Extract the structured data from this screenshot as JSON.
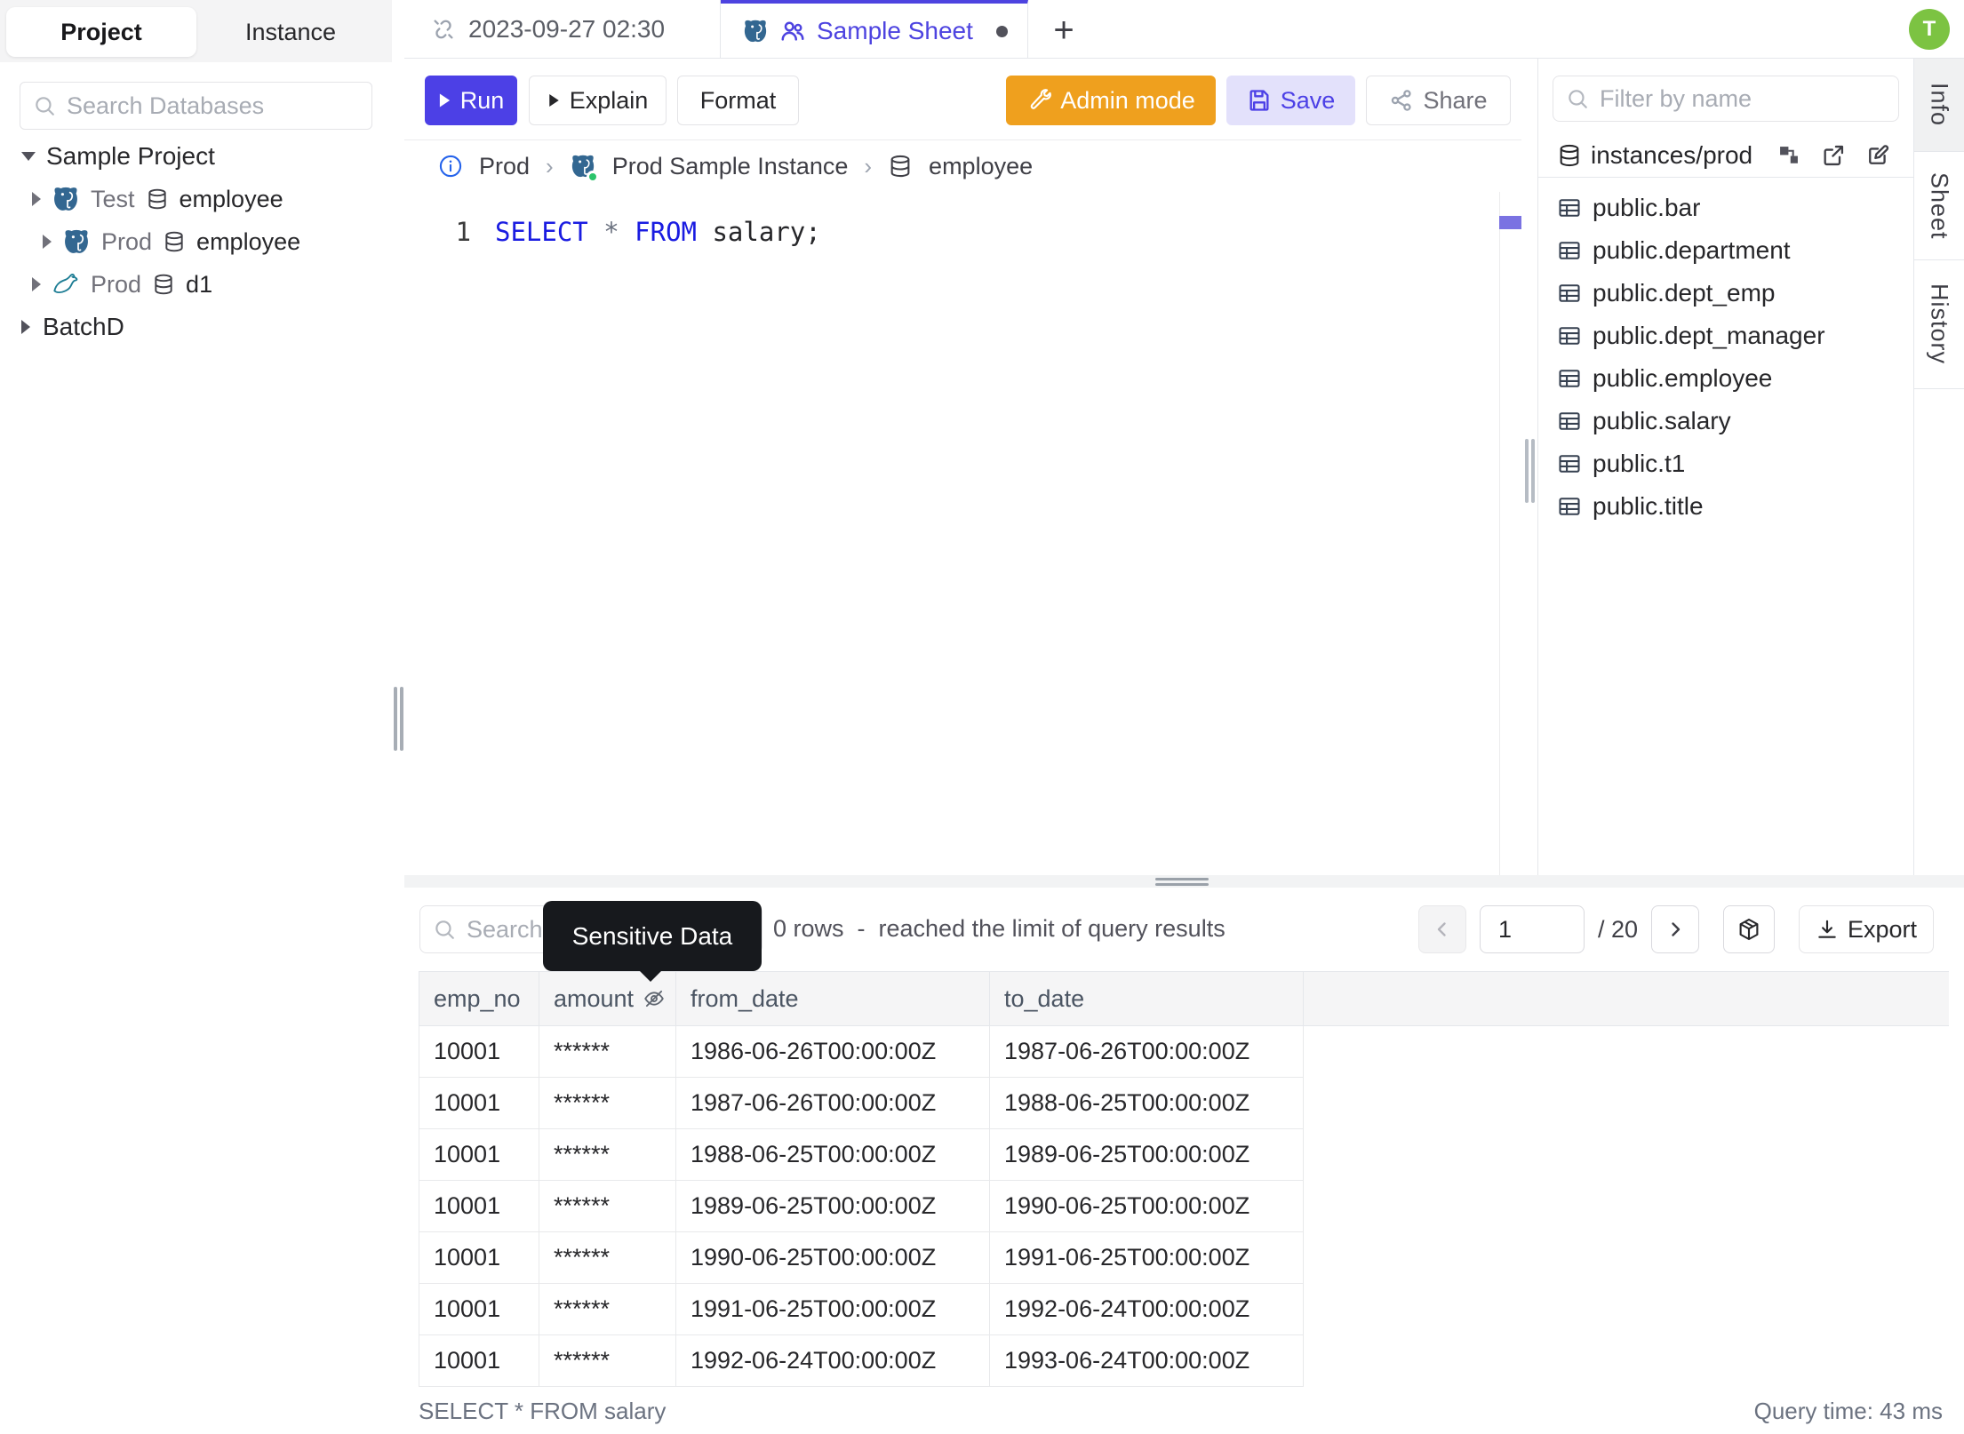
{
  "app": {
    "avatar_initial": "T"
  },
  "sidebar": {
    "tabs": {
      "project": "Project",
      "instance": "Instance"
    },
    "search_placeholder": "Search Databases",
    "tree": {
      "root_label": "Sample Project",
      "databases": [
        {
          "env": "Test",
          "name": "employee",
          "engine": "postgresql"
        },
        {
          "env": "Prod",
          "name": "employee",
          "engine": "postgresql"
        },
        {
          "env": "Prod",
          "name": "d1",
          "engine": "mysql"
        }
      ],
      "batch_label": "BatchD"
    }
  },
  "tabbar": {
    "history_tab": "2023-09-27 02:30",
    "sheet_tab": "Sample Sheet",
    "new_tab": "+"
  },
  "toolbar": {
    "run": "Run",
    "explain": "Explain",
    "format": "Format",
    "admin_mode": "Admin mode",
    "save": "Save",
    "share": "Share"
  },
  "breadcrumb": {
    "environment": "Prod",
    "instance": "Prod Sample Instance",
    "database": "employee",
    "separator": "›"
  },
  "editor": {
    "line_number": "1",
    "kw1": "SELECT",
    "star": "*",
    "kw2": "FROM",
    "rest": " salary;"
  },
  "right_panel": {
    "filter_placeholder": "Filter by name",
    "schema_path": "instances/prod",
    "tables": [
      "public.bar",
      "public.department",
      "public.dept_emp",
      "public.dept_manager",
      "public.employee",
      "public.salary",
      "public.t1",
      "public.title"
    ]
  },
  "side_tabs": {
    "info": "Info",
    "sheet": "Sheet",
    "history": "History"
  },
  "results": {
    "search_placeholder": "Search",
    "tooltip": "Sensitive Data",
    "summary": "0 rows  -  reached the limit of query results",
    "page_current": "1",
    "page_total": "/ 20",
    "export_label": "Export",
    "columns": [
      "emp_no",
      "amount",
      "from_date",
      "to_date"
    ],
    "rows": [
      [
        "10001",
        "******",
        "1986-06-26T00:00:00Z",
        "1987-06-26T00:00:00Z"
      ],
      [
        "10001",
        "******",
        "1987-06-26T00:00:00Z",
        "1988-06-25T00:00:00Z"
      ],
      [
        "10001",
        "******",
        "1988-06-25T00:00:00Z",
        "1989-06-25T00:00:00Z"
      ],
      [
        "10001",
        "******",
        "1989-06-25T00:00:00Z",
        "1990-06-25T00:00:00Z"
      ],
      [
        "10001",
        "******",
        "1990-06-25T00:00:00Z",
        "1991-06-25T00:00:00Z"
      ],
      [
        "10001",
        "******",
        "1991-06-25T00:00:00Z",
        "1992-06-24T00:00:00Z"
      ],
      [
        "10001",
        "******",
        "1992-06-24T00:00:00Z",
        "1993-06-24T00:00:00Z"
      ]
    ],
    "status_query": "SELECT * FROM salary",
    "status_time": "Query time: 43 ms"
  },
  "colors": {
    "accent": "#4c40e6",
    "accent_light": "#e3e1fb",
    "admin_orange": "#efa01e",
    "avatar_green": "#7cc342",
    "selection": "#e9e8fc",
    "keyword_blue": "#1a1ce1",
    "tooltip_bg": "#17191d"
  }
}
